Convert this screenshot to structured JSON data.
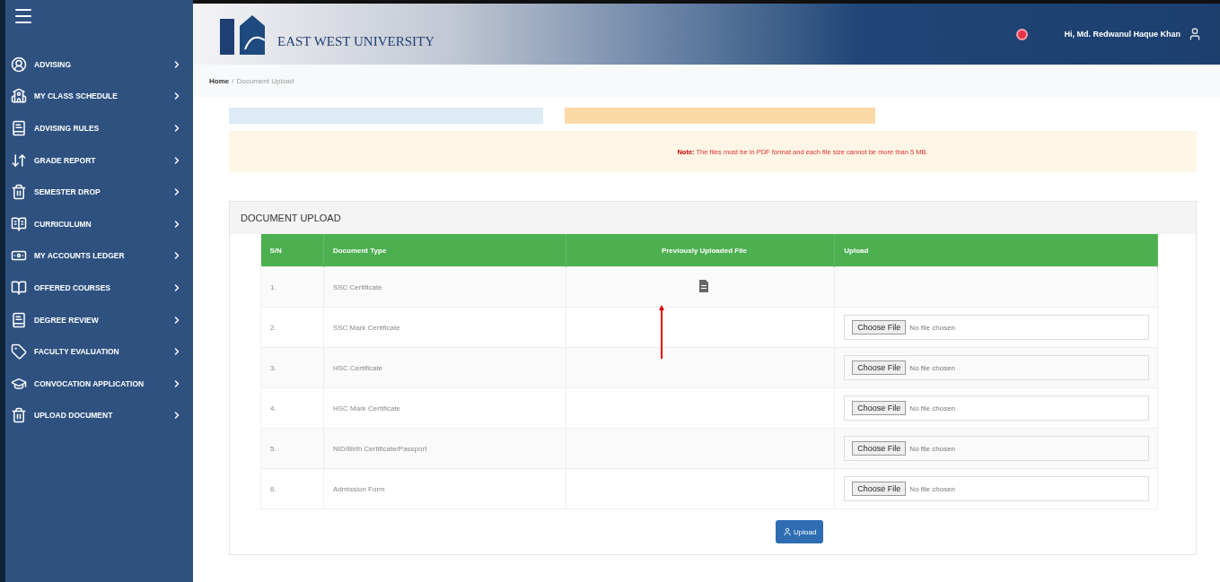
{
  "header": {
    "logo_text": "EAST WEST UNIVERSITY",
    "user_greeting": "Hi, Md. Redwanul Haque Khan"
  },
  "sidebar": {
    "items": [
      {
        "label": "ADVISING"
      },
      {
        "label": "MY CLASS SCHEDULE"
      },
      {
        "label": "ADVISING RULES"
      },
      {
        "label": "GRADE REPORT"
      },
      {
        "label": "SEMESTER DROP"
      },
      {
        "label": "CURRICULUMN"
      },
      {
        "label": "MY ACCOUNTS LEDGER"
      },
      {
        "label": "OFFERED COURSES"
      },
      {
        "label": "DEGREE REVIEW"
      },
      {
        "label": "FACULTY EVALUATION"
      },
      {
        "label": "CONVOCATION APPLICATION"
      },
      {
        "label": "UPLOAD DOCUMENT"
      }
    ]
  },
  "breadcrumb": [
    "Home",
    "/",
    "Document Upload"
  ],
  "note": "**Note:** The files must be in PDF format and each file size cannot be more than 5 MB.",
  "panel": {
    "title": "DOCUMENT UPLOAD",
    "table": {
      "columns": [
        "S/N",
        "Document Type",
        "Previously Uploaded File",
        "Upload"
      ],
      "rows": [
        {
          "sn": "1.",
          "type": "SSC Certificate",
          "kind": "uploaded"
        },
        {
          "sn": "2.",
          "type": "SSC Mark Certificate",
          "kind": "field",
          "button": "Choose File",
          "status": "No file chosen"
        },
        {
          "sn": "3.",
          "type": "HSC Certificate",
          "kind": "field",
          "button": "Choose File",
          "status": "No file chosen"
        },
        {
          "sn": "4.",
          "type": "HSC Mark Certificate",
          "kind": "field",
          "button": "Choose File",
          "status": "No file chosen"
        },
        {
          "sn": "5.",
          "type": "NID/Birth Certificate/Passport",
          "kind": "field",
          "button": "Choose File",
          "status": "No file chosen"
        },
        {
          "sn": "6.",
          "type": "Admission Form",
          "kind": "field",
          "button": "Choose File",
          "status": "No file chosen"
        }
      ]
    },
    "submit": "Upload"
  }
}
